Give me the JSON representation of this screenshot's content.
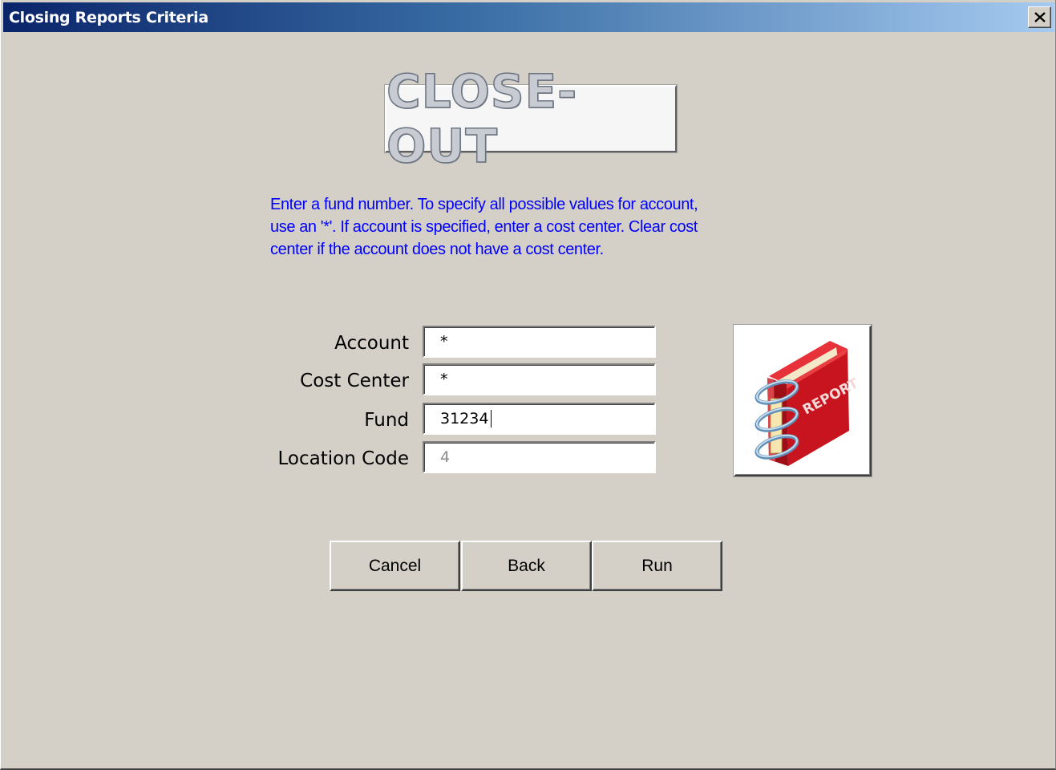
{
  "window": {
    "title": "Closing Reports Criteria",
    "close_icon": "close-icon"
  },
  "logo": {
    "text": "CLOSE-OUT"
  },
  "instructions": {
    "lines": [
      "Enter a fund number.  To specify all possible values for account,",
      "use an '*'. If account is specified, enter a cost center. Clear cost",
      "center if the account does not have a cost center."
    ]
  },
  "form": {
    "account": {
      "label": "Account",
      "value": "*"
    },
    "cost_center": {
      "label": "Cost Center",
      "value": "*"
    },
    "fund": {
      "label": "Fund",
      "value": "31234"
    },
    "location_code": {
      "label": "Location Code",
      "value": "4"
    }
  },
  "report_icon": {
    "name": "report-binder-icon",
    "lettering": "REPORT"
  },
  "buttons": {
    "cancel": "Cancel",
    "back": "Back",
    "run": "Run"
  },
  "colors": {
    "window_bg": "#d4d0c8",
    "title_gradient_start": "#0a246a",
    "title_gradient_end": "#a6caf0",
    "instruction_text": "#0000ff",
    "binder_red": "#c8141e"
  }
}
